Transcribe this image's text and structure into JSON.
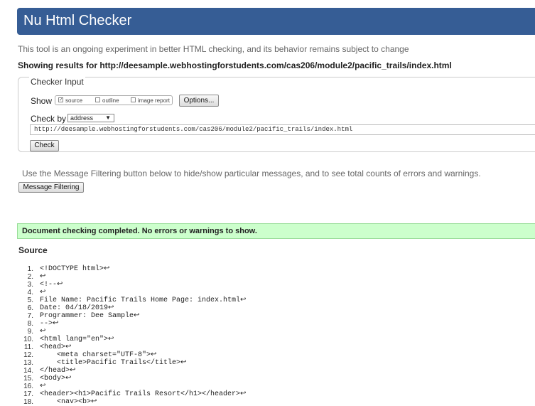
{
  "banner": {
    "title": "Nu Html Checker"
  },
  "intro": "This tool is an ongoing experiment in better HTML checking, and its behavior remains subject to change",
  "showing": "Showing results for http://deesample.webhostingforstudents.com/cas206/module2/pacific_trails/index.html",
  "checker_input": {
    "legend": "Checker Input",
    "show_label": "Show",
    "options": [
      {
        "label": "source",
        "checked": true
      },
      {
        "label": "outline",
        "checked": false
      },
      {
        "label": "image report",
        "checked": false
      }
    ],
    "options_button": "Options...",
    "check_by_label": "Check by",
    "check_by_value": "address",
    "url_value": "http://deesample.webhostingforstudents.com/cas206/module2/pacific_trails/index.html",
    "check_button": "Check"
  },
  "filter": {
    "text": "Use the Message Filtering button below to hide/show particular messages, and to see total counts of errors and warnings.",
    "button": "Message Filtering"
  },
  "result": "Document checking completed. No errors or warnings to show.",
  "source": {
    "heading": "Source",
    "lines": [
      {
        "n": "1.",
        "code": "<!DOCTYPE html>↩"
      },
      {
        "n": "2.",
        "code": "↩"
      },
      {
        "n": "3.",
        "code": "<!--↩"
      },
      {
        "n": "4.",
        "code": "↩"
      },
      {
        "n": "5.",
        "code": "File Name: Pacific Trails Home Page: index.html↩"
      },
      {
        "n": "6.",
        "code": "Date: 04/18/2019↩"
      },
      {
        "n": "7.",
        "code": "Programmer: Dee Sample↩"
      },
      {
        "n": "8.",
        "code": "-->↩"
      },
      {
        "n": "9.",
        "code": "↩"
      },
      {
        "n": "10.",
        "code": "<html lang=\"en\">↩"
      },
      {
        "n": "11.",
        "code": "<head>↩"
      },
      {
        "n": "12.",
        "code": "    <meta charset=\"UTF-8\">↩"
      },
      {
        "n": "13.",
        "code": "    <title>Pacific Trails</title>↩"
      },
      {
        "n": "14.",
        "code": "</head>↩"
      },
      {
        "n": "15.",
        "code": "<body>↩"
      },
      {
        "n": "16.",
        "code": "↩"
      },
      {
        "n": "17.",
        "code": "<header><h1>Pacific Trails Resort</h1></header>↩"
      },
      {
        "n": "18.",
        "code": "    <nav><b>↩"
      }
    ]
  }
}
